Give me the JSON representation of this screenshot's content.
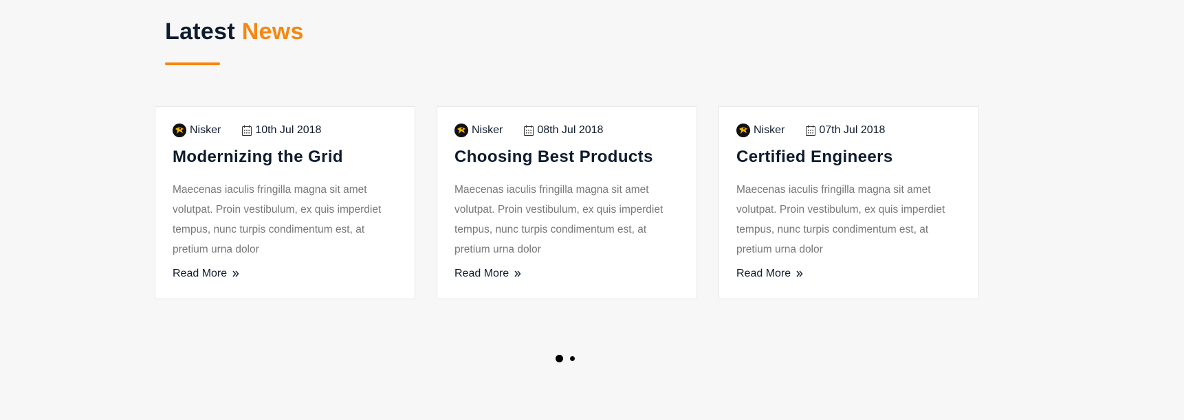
{
  "section": {
    "title_main": "Latest",
    "title_accent": "News",
    "accent_color": "#f68712"
  },
  "cards": [
    {
      "author": "Nisker",
      "date": "10th Jul 2018",
      "title": "Modernizing the Grid",
      "excerpt": "Maecenas iaculis fringilla magna sit amet volutpat. Proin vestibulum, ex quis imperdiet tempus, nunc turpis condimentum est, at pretium urna dolor",
      "link_label": "Read More"
    },
    {
      "author": "Nisker",
      "date": "08th Jul 2018",
      "title": "Choosing Best Products",
      "excerpt": "Maecenas iaculis fringilla magna sit amet volutpat. Proin vestibulum, ex quis imperdiet tempus, nunc turpis condimentum est, at pretium urna dolor",
      "link_label": "Read More"
    },
    {
      "author": "Nisker",
      "date": "07th Jul 2018",
      "title": "Certified Engineers",
      "excerpt": "Maecenas iaculis fringilla magna sit amet volutpat. Proin vestibulum, ex quis imperdiet tempus, nunc turpis condimentum est, at pretium urna dolor",
      "link_label": "Read More"
    }
  ],
  "carousel": {
    "pages": 2,
    "active_page": 1
  },
  "icons": {
    "author": "author-avatar-icon",
    "date": "calendar-icon",
    "link": "double-chevron-right-icon"
  }
}
